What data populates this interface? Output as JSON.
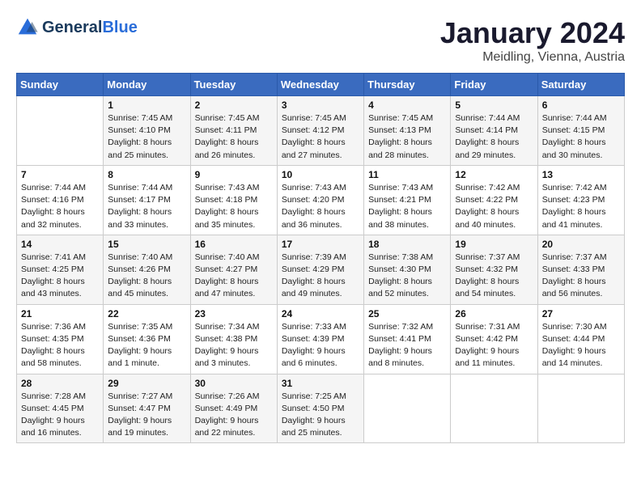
{
  "header": {
    "logo_general": "General",
    "logo_blue": "Blue",
    "month_title": "January 2024",
    "location": "Meidling, Vienna, Austria"
  },
  "days_of_week": [
    "Sunday",
    "Monday",
    "Tuesday",
    "Wednesday",
    "Thursday",
    "Friday",
    "Saturday"
  ],
  "weeks": [
    [
      {
        "day": "",
        "sunrise": "",
        "sunset": "",
        "daylight": ""
      },
      {
        "day": "1",
        "sunrise": "Sunrise: 7:45 AM",
        "sunset": "Sunset: 4:10 PM",
        "daylight": "Daylight: 8 hours and 25 minutes."
      },
      {
        "day": "2",
        "sunrise": "Sunrise: 7:45 AM",
        "sunset": "Sunset: 4:11 PM",
        "daylight": "Daylight: 8 hours and 26 minutes."
      },
      {
        "day": "3",
        "sunrise": "Sunrise: 7:45 AM",
        "sunset": "Sunset: 4:12 PM",
        "daylight": "Daylight: 8 hours and 27 minutes."
      },
      {
        "day": "4",
        "sunrise": "Sunrise: 7:45 AM",
        "sunset": "Sunset: 4:13 PM",
        "daylight": "Daylight: 8 hours and 28 minutes."
      },
      {
        "day": "5",
        "sunrise": "Sunrise: 7:44 AM",
        "sunset": "Sunset: 4:14 PM",
        "daylight": "Daylight: 8 hours and 29 minutes."
      },
      {
        "day": "6",
        "sunrise": "Sunrise: 7:44 AM",
        "sunset": "Sunset: 4:15 PM",
        "daylight": "Daylight: 8 hours and 30 minutes."
      }
    ],
    [
      {
        "day": "7",
        "sunrise": "Sunrise: 7:44 AM",
        "sunset": "Sunset: 4:16 PM",
        "daylight": "Daylight: 8 hours and 32 minutes."
      },
      {
        "day": "8",
        "sunrise": "Sunrise: 7:44 AM",
        "sunset": "Sunset: 4:17 PM",
        "daylight": "Daylight: 8 hours and 33 minutes."
      },
      {
        "day": "9",
        "sunrise": "Sunrise: 7:43 AM",
        "sunset": "Sunset: 4:18 PM",
        "daylight": "Daylight: 8 hours and 35 minutes."
      },
      {
        "day": "10",
        "sunrise": "Sunrise: 7:43 AM",
        "sunset": "Sunset: 4:20 PM",
        "daylight": "Daylight: 8 hours and 36 minutes."
      },
      {
        "day": "11",
        "sunrise": "Sunrise: 7:43 AM",
        "sunset": "Sunset: 4:21 PM",
        "daylight": "Daylight: 8 hours and 38 minutes."
      },
      {
        "day": "12",
        "sunrise": "Sunrise: 7:42 AM",
        "sunset": "Sunset: 4:22 PM",
        "daylight": "Daylight: 8 hours and 40 minutes."
      },
      {
        "day": "13",
        "sunrise": "Sunrise: 7:42 AM",
        "sunset": "Sunset: 4:23 PM",
        "daylight": "Daylight: 8 hours and 41 minutes."
      }
    ],
    [
      {
        "day": "14",
        "sunrise": "Sunrise: 7:41 AM",
        "sunset": "Sunset: 4:25 PM",
        "daylight": "Daylight: 8 hours and 43 minutes."
      },
      {
        "day": "15",
        "sunrise": "Sunrise: 7:40 AM",
        "sunset": "Sunset: 4:26 PM",
        "daylight": "Daylight: 8 hours and 45 minutes."
      },
      {
        "day": "16",
        "sunrise": "Sunrise: 7:40 AM",
        "sunset": "Sunset: 4:27 PM",
        "daylight": "Daylight: 8 hours and 47 minutes."
      },
      {
        "day": "17",
        "sunrise": "Sunrise: 7:39 AM",
        "sunset": "Sunset: 4:29 PM",
        "daylight": "Daylight: 8 hours and 49 minutes."
      },
      {
        "day": "18",
        "sunrise": "Sunrise: 7:38 AM",
        "sunset": "Sunset: 4:30 PM",
        "daylight": "Daylight: 8 hours and 52 minutes."
      },
      {
        "day": "19",
        "sunrise": "Sunrise: 7:37 AM",
        "sunset": "Sunset: 4:32 PM",
        "daylight": "Daylight: 8 hours and 54 minutes."
      },
      {
        "day": "20",
        "sunrise": "Sunrise: 7:37 AM",
        "sunset": "Sunset: 4:33 PM",
        "daylight": "Daylight: 8 hours and 56 minutes."
      }
    ],
    [
      {
        "day": "21",
        "sunrise": "Sunrise: 7:36 AM",
        "sunset": "Sunset: 4:35 PM",
        "daylight": "Daylight: 8 hours and 58 minutes."
      },
      {
        "day": "22",
        "sunrise": "Sunrise: 7:35 AM",
        "sunset": "Sunset: 4:36 PM",
        "daylight": "Daylight: 9 hours and 1 minute."
      },
      {
        "day": "23",
        "sunrise": "Sunrise: 7:34 AM",
        "sunset": "Sunset: 4:38 PM",
        "daylight": "Daylight: 9 hours and 3 minutes."
      },
      {
        "day": "24",
        "sunrise": "Sunrise: 7:33 AM",
        "sunset": "Sunset: 4:39 PM",
        "daylight": "Daylight: 9 hours and 6 minutes."
      },
      {
        "day": "25",
        "sunrise": "Sunrise: 7:32 AM",
        "sunset": "Sunset: 4:41 PM",
        "daylight": "Daylight: 9 hours and 8 minutes."
      },
      {
        "day": "26",
        "sunrise": "Sunrise: 7:31 AM",
        "sunset": "Sunset: 4:42 PM",
        "daylight": "Daylight: 9 hours and 11 minutes."
      },
      {
        "day": "27",
        "sunrise": "Sunrise: 7:30 AM",
        "sunset": "Sunset: 4:44 PM",
        "daylight": "Daylight: 9 hours and 14 minutes."
      }
    ],
    [
      {
        "day": "28",
        "sunrise": "Sunrise: 7:28 AM",
        "sunset": "Sunset: 4:45 PM",
        "daylight": "Daylight: 9 hours and 16 minutes."
      },
      {
        "day": "29",
        "sunrise": "Sunrise: 7:27 AM",
        "sunset": "Sunset: 4:47 PM",
        "daylight": "Daylight: 9 hours and 19 minutes."
      },
      {
        "day": "30",
        "sunrise": "Sunrise: 7:26 AM",
        "sunset": "Sunset: 4:49 PM",
        "daylight": "Daylight: 9 hours and 22 minutes."
      },
      {
        "day": "31",
        "sunrise": "Sunrise: 7:25 AM",
        "sunset": "Sunset: 4:50 PM",
        "daylight": "Daylight: 9 hours and 25 minutes."
      },
      {
        "day": "",
        "sunrise": "",
        "sunset": "",
        "daylight": ""
      },
      {
        "day": "",
        "sunrise": "",
        "sunset": "",
        "daylight": ""
      },
      {
        "day": "",
        "sunrise": "",
        "sunset": "",
        "daylight": ""
      }
    ]
  ]
}
